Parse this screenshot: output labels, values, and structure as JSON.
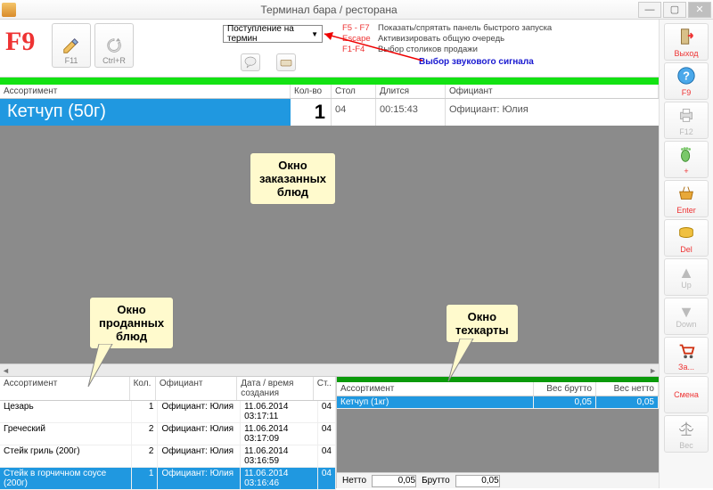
{
  "window": {
    "title": "Терминал бара / ресторана",
    "min": "—",
    "max": "▢",
    "close": "✕"
  },
  "ribbon": {
    "f9": "F9",
    "btn_f11": "F11",
    "btn_ctrl_r": "Ctrl+R",
    "dropdown": "Поступление на термин",
    "shortcuts": [
      {
        "key": "F5 - F7",
        "desc": "Показать/спрятать панель быстрого запуска"
      },
      {
        "key": "Escape",
        "desc": "Активизировать общую очередь"
      },
      {
        "key": "F1-F4",
        "desc": "Выбор столиков продажи"
      }
    ],
    "blue_note": "Выбор звукового сигнала"
  },
  "orders": {
    "headers": {
      "a": "Ассортимент",
      "k": "Кол-во",
      "s": "Стол",
      "d": "Длится",
      "o": "Официант"
    },
    "rows": [
      {
        "name": "Кетчуп (50г)",
        "kol": "1",
        "stol": "04",
        "dur": "00:15:43",
        "waiter": "Официант: Юлия"
      }
    ]
  },
  "callouts": {
    "ordered": "Окно\nзаказанных\nблюд",
    "sold": "Окно\nпроданных\nблюд",
    "tech": "Окно\nтехкарты"
  },
  "sold": {
    "headers": {
      "a": "Ассортимент",
      "k": "Кол.",
      "o": "Официант",
      "t": "Дата / время\nсоздания",
      "s": "Ст.."
    },
    "rows": [
      {
        "a": "Цезарь",
        "k": "1",
        "o": "Официант: Юлия",
        "t": "11.06.2014 03:17:11",
        "s": "04"
      },
      {
        "a": "Греческий",
        "k": "2",
        "o": "Официант: Юлия",
        "t": "11.06.2014 03:17:09",
        "s": "04"
      },
      {
        "a": "Стейк гриль (200г)",
        "k": "2",
        "o": "Официант: Юлия",
        "t": "11.06.2014 03:16:59",
        "s": "04"
      },
      {
        "a": "Стейк в горчичном соусе (200г)",
        "k": "1",
        "o": "Официант: Юлия",
        "t": "11.06.2014 03:16:46",
        "s": "04",
        "sel": true
      }
    ]
  },
  "tech": {
    "headers": {
      "a": "Ассортимент",
      "b": "Вес брутто",
      "n": "Вес нетто"
    },
    "rows": [
      {
        "a": "Кетчуп (1кг)",
        "b": "0,05",
        "n": "0,05",
        "sel": true
      }
    ],
    "net_label": "Нетто",
    "net_val": "0,05",
    "gross_label": "Брутто",
    "gross_val": "0,05"
  },
  "side": {
    "exit": "Выход",
    "f9": "F9",
    "f12": "F12",
    "plus": "+",
    "enter": "Enter",
    "del": "Del",
    "up": "Up",
    "down": "Down",
    "order": "За...",
    "smena": "Смена",
    "ves": "Вес"
  }
}
